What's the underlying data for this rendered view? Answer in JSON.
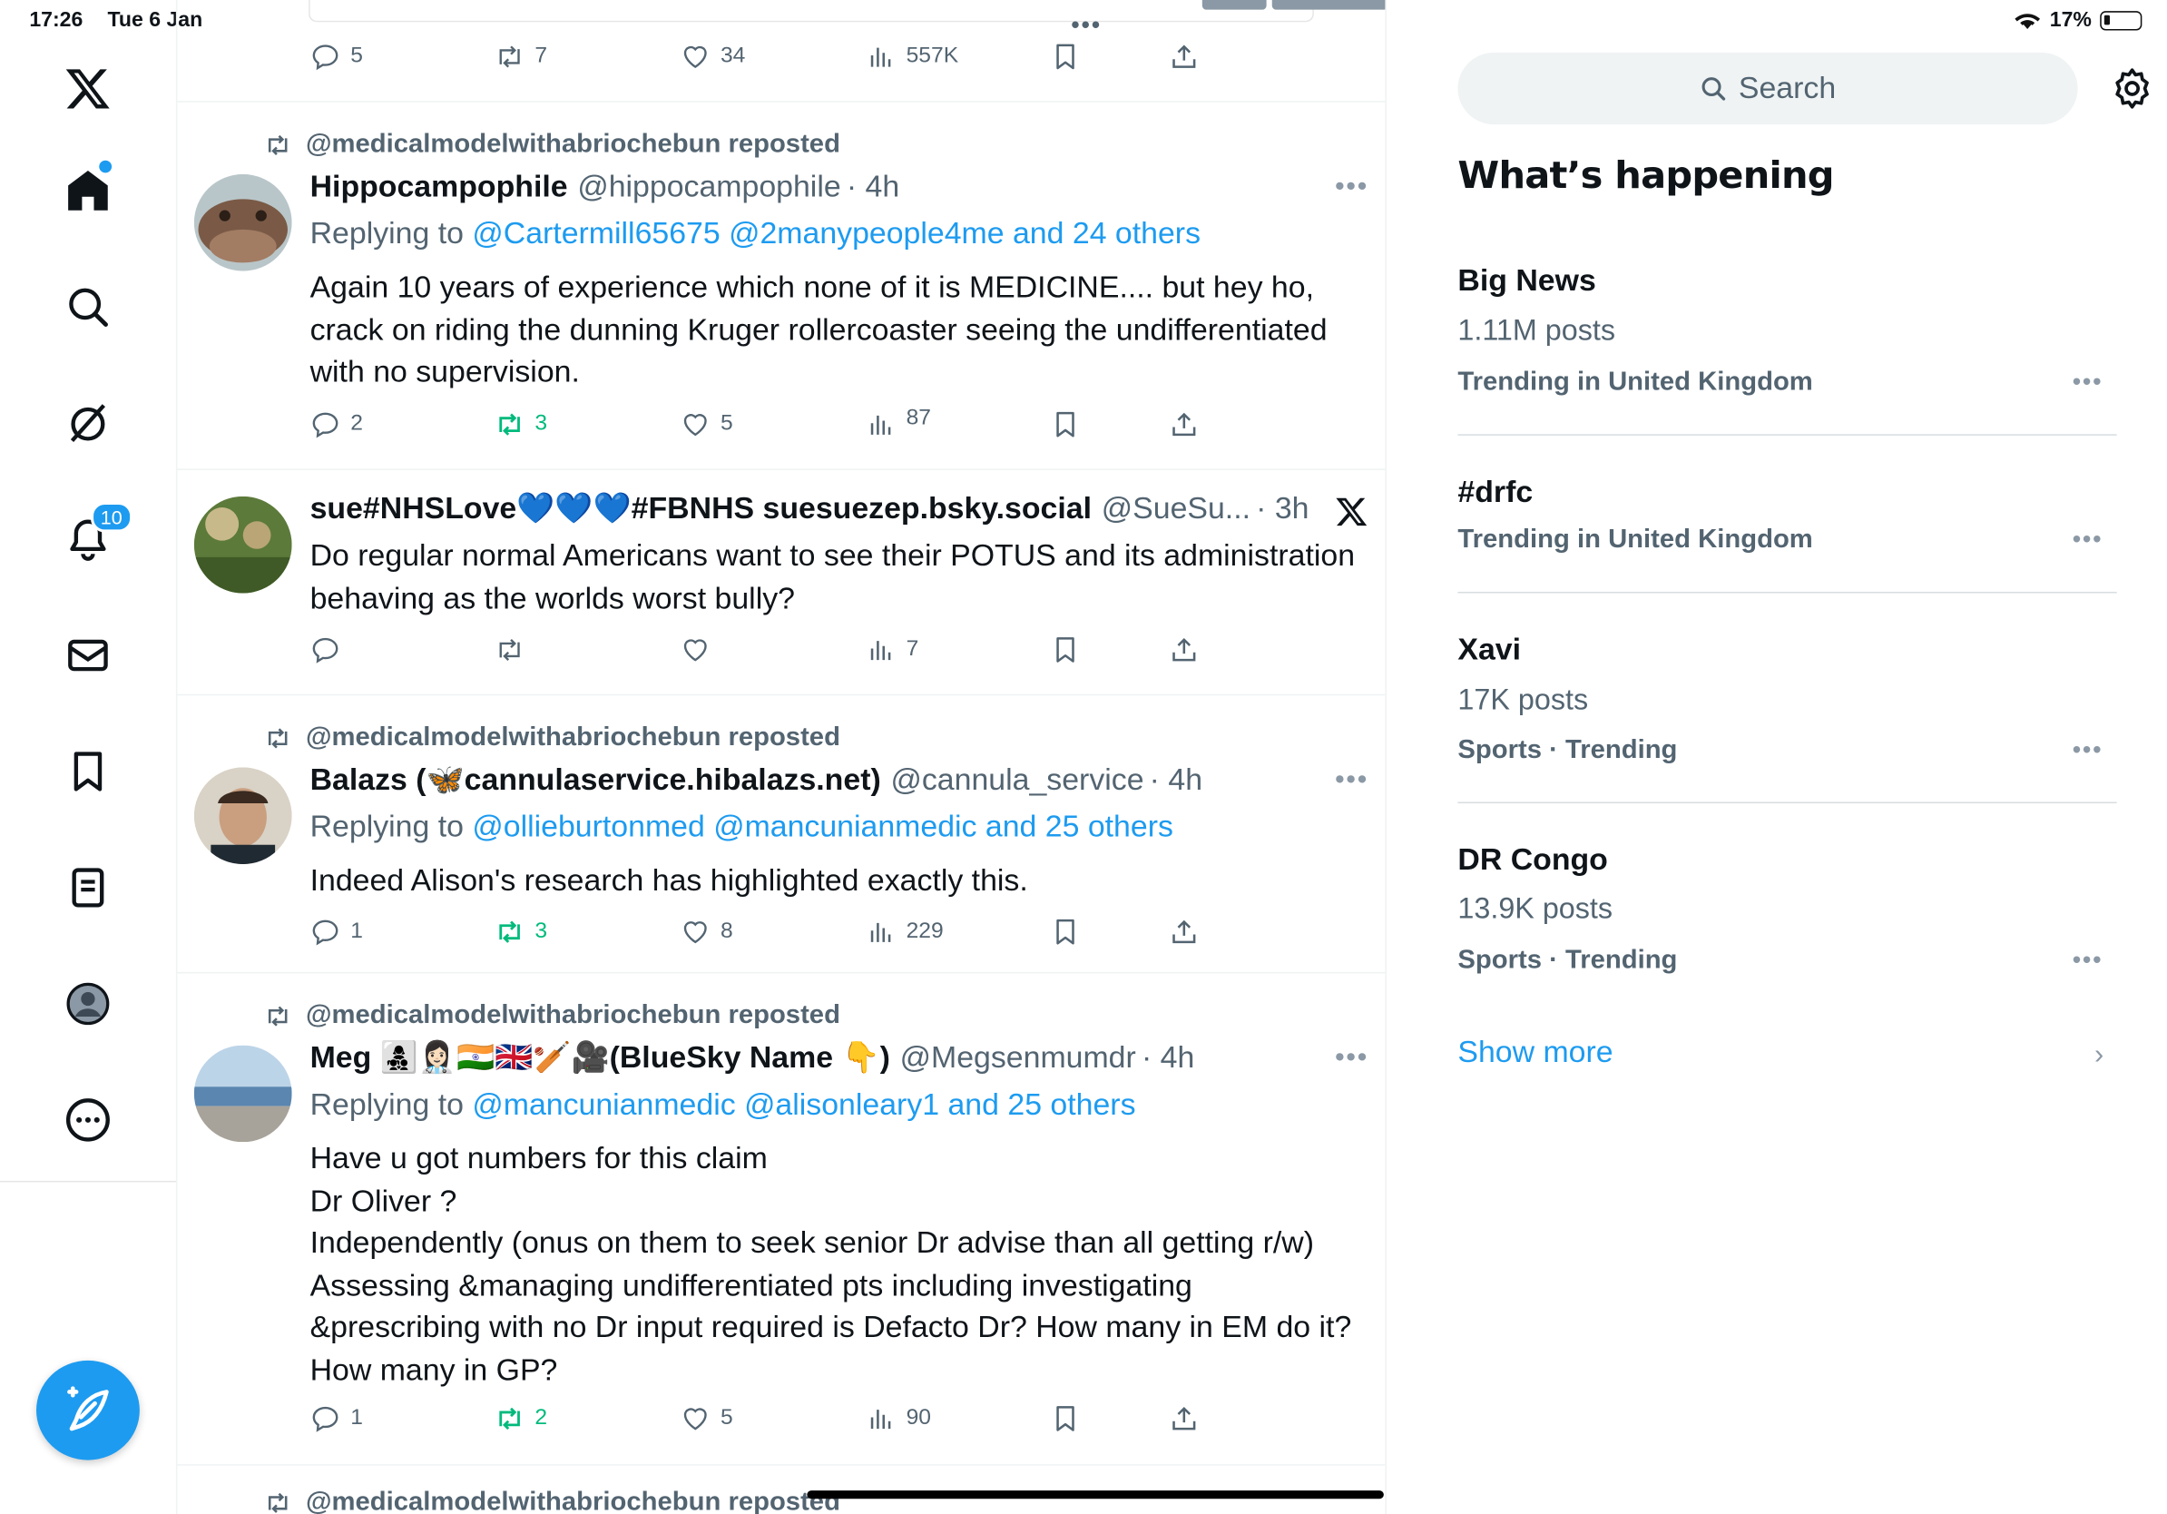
{
  "status_bar": {
    "time": "17:26",
    "date": "Tue 6 Jan",
    "battery": "17%"
  },
  "nav": {
    "notifications_badge": "10",
    "items": [
      "x-logo",
      "home",
      "explore",
      "grok",
      "notifications",
      "messages",
      "bookmarks",
      "lists",
      "profile",
      "more"
    ]
  },
  "previous_tweet": {
    "replies": "5",
    "reposts": "7",
    "likes": "34",
    "views": "557K"
  },
  "tweets": [
    {
      "repost_by": "@medicalmodelwithabriochebun reposted",
      "name": "Hippocampophile",
      "handle": "@hippocampophile",
      "time": "· 4h",
      "replying_prefix": "Replying to",
      "replying_to": "@Cartermill65675 @2manypeople4me and 24 others",
      "text": "Again 10 years of experience which none of it is MEDICINE.... but hey ho, crack on riding the dunning Kruger rollercoaster seeing the undifferentiated with no supervision.",
      "replies": "2",
      "reposts": "3",
      "likes": "5",
      "views": "87"
    },
    {
      "name": "sue#NHSLove💙💙💙#FBNHS suesuezep.bsky.social",
      "handle": "@SueSu...",
      "time": "· 3h",
      "text": "Do  regular normal Americans want to see their POTUS and its administration behaving as the worlds worst bully?",
      "replies": "",
      "reposts": "",
      "likes": "",
      "views": "7"
    },
    {
      "repost_by": "@medicalmodelwithabriochebun reposted",
      "name": "Balazs (🦋cannulaservice.hibalazs.net)",
      "handle": "@cannula_service",
      "time": "· 4h",
      "replying_prefix": "Replying to",
      "replying_to": "@ollieburtonmed @mancunianmedic and 25 others",
      "text": "Indeed Alison's research has highlighted exactly this.",
      "replies": "1",
      "reposts": "3",
      "likes": "8",
      "views": "229"
    },
    {
      "repost_by": "@medicalmodelwithabriochebun reposted",
      "name": "Meg 👩‍👧‍👦👩🏻‍⚕️🇮🇳🇬🇧🏏🎥(BlueSky Name 👇)",
      "handle": "@Megsenmumdr",
      "time": "· 4h",
      "replying_prefix": "Replying to",
      "replying_to": "@mancunianmedic @alisonleary1 and 25 others",
      "text": "Have u got numbers for this claim\nDr Oliver ?\nIndependently (onus on them to seek senior Dr advise than all getting r/w)\nAssessing &managing undifferentiated pts including investigating &prescribing with no Dr input required is Defacto Dr? How many in EM do it?\nHow many in GP?",
      "replies": "1",
      "reposts": "2",
      "likes": "5",
      "views": "90"
    }
  ],
  "next_repost": "@medicalmodelwithabriochebun reposted",
  "sidebar": {
    "search_placeholder": "Search",
    "heading": "What’s happening",
    "trends": [
      {
        "title": "Big News",
        "posts": "1.11M posts",
        "context": "Trending in United Kingdom"
      },
      {
        "title": "#drfc",
        "posts": "",
        "context": "Trending in United Kingdom"
      },
      {
        "title": "Xavi",
        "posts": "17K posts",
        "context": "Sports · Trending"
      },
      {
        "title": "DR Congo",
        "posts": "13.9K posts",
        "context": "Sports · Trending"
      }
    ],
    "show_more": "Show more"
  },
  "colors": {
    "accent": "#1d9bf0",
    "repost_green": "#00ba7c",
    "muted": "#536471"
  }
}
